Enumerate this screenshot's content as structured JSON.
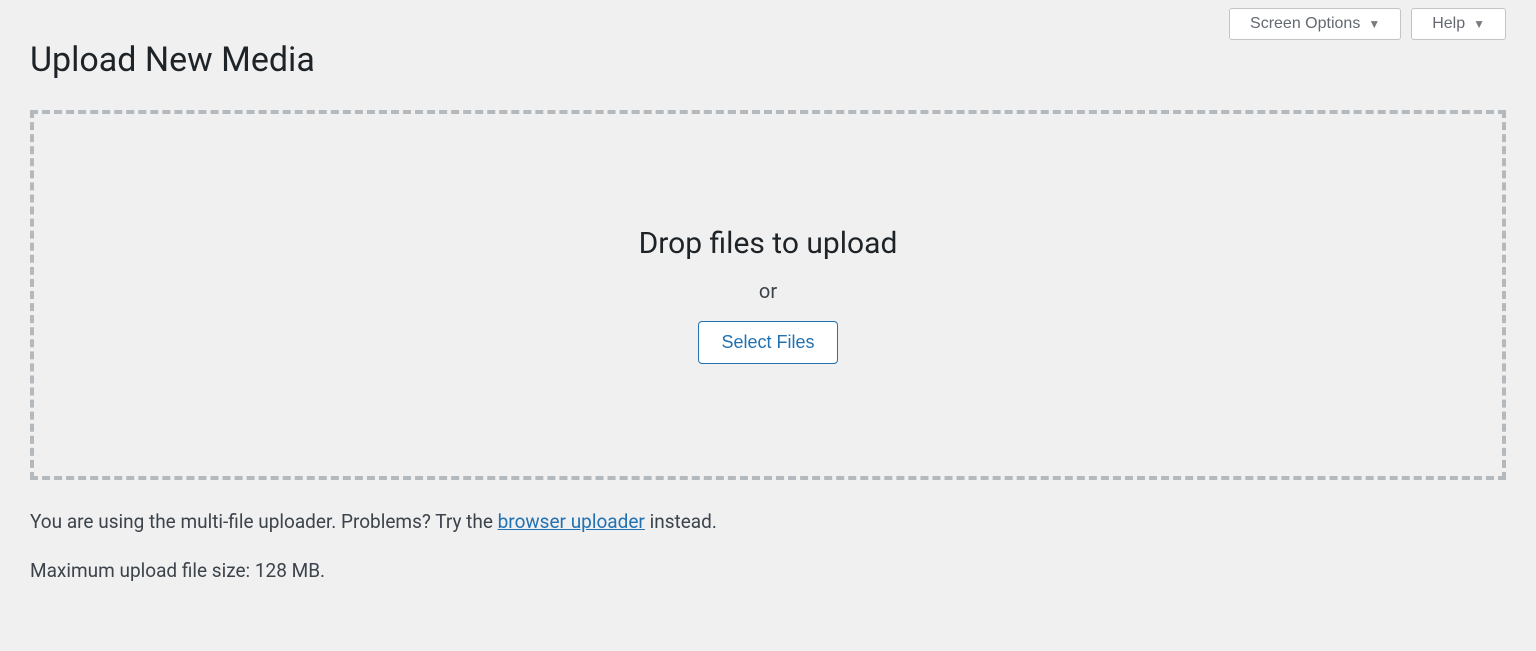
{
  "header": {
    "screen_options_label": "Screen Options",
    "help_label": "Help"
  },
  "page": {
    "title": "Upload New Media"
  },
  "dropzone": {
    "instruction": "Drop files to upload",
    "or_label": "or",
    "select_button": "Select Files"
  },
  "info": {
    "prefix": "You are using the multi-file uploader. Problems? Try the ",
    "link_text": "browser uploader",
    "suffix": " instead."
  },
  "max_upload": {
    "text": "Maximum upload file size: 128 MB."
  }
}
